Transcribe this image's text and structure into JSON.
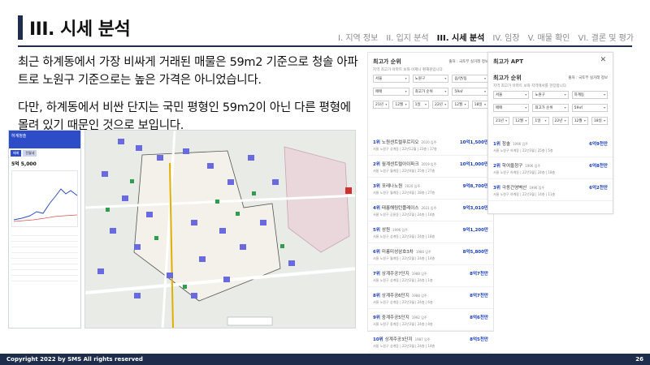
{
  "header": {
    "title": "III. 시세 분석"
  },
  "nav": {
    "steps": [
      "I. 지역 정보",
      "II. 입지 분석",
      "III. 시세 분석",
      "IV. 임장",
      "V. 매물 확인",
      "VI. 결론 및 평가"
    ],
    "active_index": 2
  },
  "body": {
    "para1": "최근 하계동에서 가장 비싸게 거래된 매물은 59m2 기준으로 청솔 아파트로 노원구 기준으로는 높은 가격은 아니었습니다.",
    "para2": "다만, 하계동에서 비싼 단지는 국민 평형인 59m2이 아닌 다른 평형에 몰려 있기 때문인 것으로 보입니다."
  },
  "phone": {
    "title": "하계청솔",
    "tab1": "매매",
    "tab2": "전월세",
    "price": "5억 5,000"
  },
  "panel1": {
    "title": "최고가 순위",
    "source": "출처 : 국토부 실거래 정보",
    "subtitle": "지역 최고가 아파트 보좌 이제니 편재원입니다.",
    "filters": [
      "서울",
      "노원구",
      "읍/면/동",
      "매매",
      "최고가 순위",
      "59㎡",
      "21년",
      "12월",
      "1일",
      "22년",
      "12월",
      "18일"
    ],
    "ranks": [
      {
        "n": "1위",
        "name": "노원센트럴푸르지오",
        "year": "2020 입주",
        "price": "10억1,500만",
        "meta": "서울 노원구 상계동 | 22년12월 | 23층 | 17층"
      },
      {
        "n": "2위",
        "name": "월계센트럴아이파크",
        "year": "2019 입주",
        "price": "10억1,000만",
        "meta": "서울 노원구 월계동 | 22년4월 | 25층 | 27층"
      },
      {
        "n": "3위",
        "name": "포레나노원",
        "year": "2020 입주",
        "price": "9억8,700만",
        "meta": "서울 노원구 월계동 | 22년4월 | 28층 | 27층"
      },
      {
        "n": "4위",
        "name": "태릉해링턴플레이스",
        "year": "2021 입주",
        "price": "9억3,010만",
        "meta": "서울 노원구 공릉동 | 22년2월 | 24층 | 14층"
      },
      {
        "n": "5위",
        "name": "성원",
        "year": "1996 입주",
        "price": "9억1,200만",
        "meta": "서울 노원구 상계동 | 22년3월 | 24층 | 18층"
      },
      {
        "n": "6위",
        "name": "미륭미성삼호3차",
        "year": "1986 입주",
        "price": "8억5,800만",
        "meta": "서울 노원구 월계동 | 22년2월 | 24층 | 14층"
      },
      {
        "n": "7위",
        "name": "상계주공7단지",
        "year": "1988 입주",
        "price": "8억7천만",
        "meta": "서울 노원구 상계동 | 22년2월 | 24층 | 1층"
      },
      {
        "n": "8위",
        "name": "상계주공6단지",
        "year": "1988 입주",
        "price": "8억7천만",
        "meta": "서울 노원구 상계동 | 22년3월 | 24층 | 6층"
      },
      {
        "n": "9위",
        "name": "중계주공5단지",
        "year": "1992 입주",
        "price": "8억6천만",
        "meta": "서울 노원구 중계동 | 22년3월 | 24층 | 8층"
      },
      {
        "n": "10위",
        "name": "상계주공3단지",
        "year": "1987 입주",
        "price": "8억5천만",
        "meta": "서울 노원구 상계동 | 22년3월 | 24층 | 14층"
      }
    ]
  },
  "panel2": {
    "heading": "최고가 APT",
    "title": "최고가 순위",
    "source": "출처 : 국토부 실거래 정보",
    "subtitle": "지역 최고가 아파트 보좌 지역에서를 관장합니다.",
    "filters": [
      "서울",
      "노원구",
      "하계동",
      "매매",
      "최고가 순위",
      "59㎡",
      "21년",
      "12월",
      "1일",
      "22년",
      "12월",
      "18일"
    ],
    "ranks": [
      {
        "n": "1위",
        "name": "청솔",
        "year": "1996 입주",
        "price": "6억9천만",
        "meta": "서울 노원구 하계동 | 22년3월 | 25층 | 5층"
      },
      {
        "n": "2위",
        "name": "학여울청구",
        "year": "1996 입주",
        "price": "6억8천만",
        "meta": "서울 노원구 하계동 | 22년3월 | 24층 | 18층"
      },
      {
        "n": "3위",
        "name": "극동건영벽산",
        "year": "1996 입주",
        "price": "6억2천만",
        "meta": "서울 노원구 하계동 | 22년3월 | 14층 | 11층"
      }
    ]
  },
  "footer": {
    "copyright": "Copyright 2022 by SMS  All rights reserved",
    "page": "26"
  },
  "colors": {
    "navy": "#1f2d4d",
    "accent_blue": "#1a3fb8"
  }
}
